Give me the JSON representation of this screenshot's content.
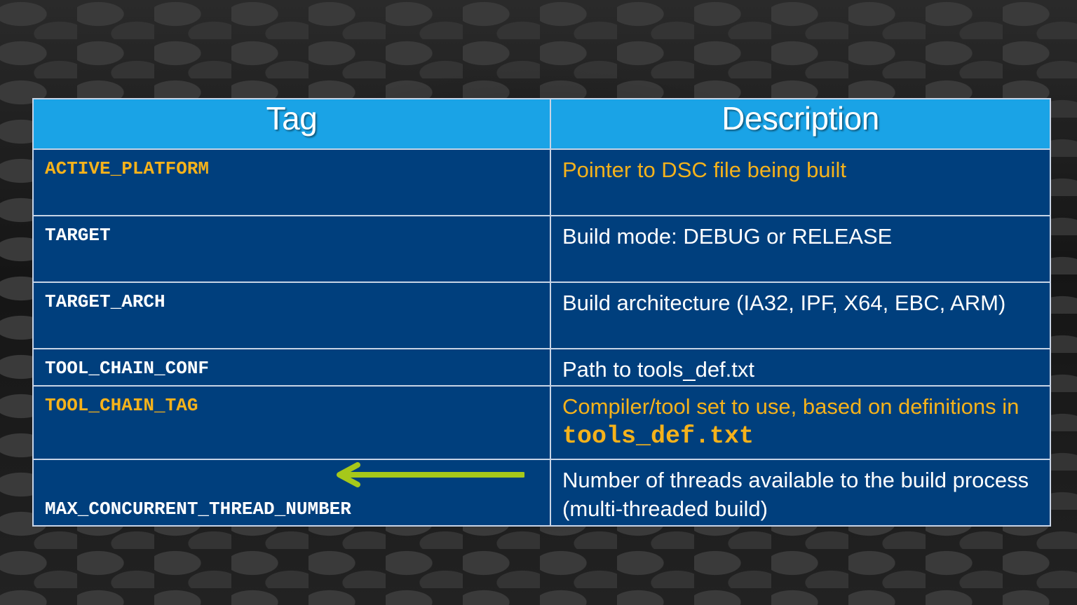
{
  "table": {
    "headers": {
      "tag": "Tag",
      "description": "Description"
    },
    "rows": [
      {
        "tag": "ACTIVE_PLATFORM",
        "description": "Pointer to DSC file being built"
      },
      {
        "tag": "TARGET",
        "description": "Build mode: DEBUG or RELEASE"
      },
      {
        "tag": "TARGET_ARCH",
        "description": "Build architecture (IA32, IPF, X64, EBC, ARM)"
      },
      {
        "tag": "TOOL_CHAIN_CONF",
        "description": "Path to tools_def.txt"
      },
      {
        "tag": "TOOL_CHAIN_TAG",
        "description_prefix": "Compiler/tool set to use, based on definitions in ",
        "description_code": "tools_def.txt"
      },
      {
        "tag": "MAX_CONCURRENT_THREAD_NUMBER",
        "description": "Number of threads available to the build process (multi-threaded build)"
      }
    ]
  },
  "colors": {
    "header_bg": "#1aa3e6",
    "row_bg": "#003f7d",
    "highlight_text": "#f5b21b",
    "arrow": "#a6c81a"
  },
  "icons": {
    "pointer_arrow": "left-arrow-icon"
  }
}
